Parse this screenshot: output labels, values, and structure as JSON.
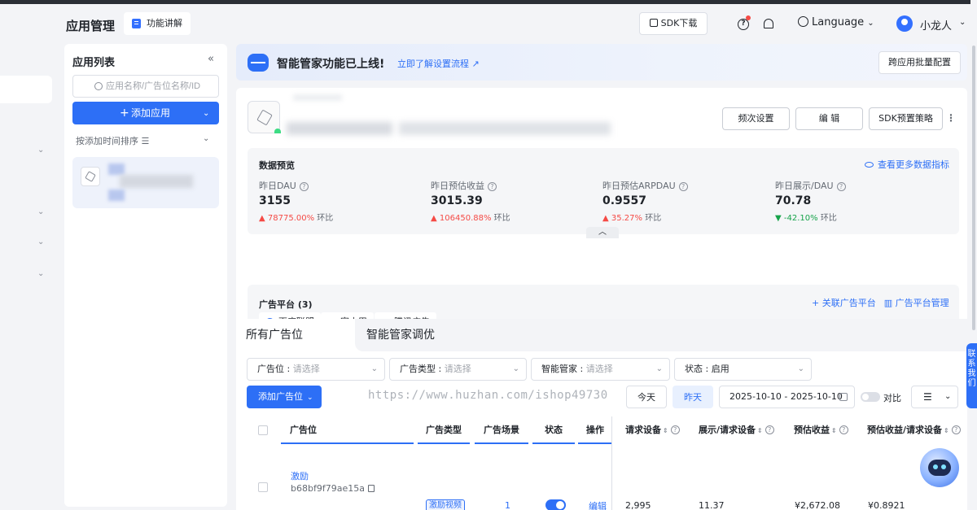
{
  "header": {
    "page_title": "应用管理",
    "func_btn": "功能讲解",
    "sdk_btn": "SDK下载",
    "language": "Language",
    "username": "小龙人"
  },
  "applist": {
    "title": "应用列表",
    "search_placeholder": "应用名称/广告位名称/ID",
    "add_label": "添加应用",
    "sort_label": "按添加时间排序"
  },
  "banner": {
    "title": "智能管家功能已上线!",
    "link": "立即了解设置流程",
    "batch_btn": "跨应用批量配置"
  },
  "app": {
    "actions": [
      "频次设置",
      "编 辑",
      "SDK预置策略"
    ]
  },
  "stats": {
    "title": "数据预览",
    "more": "查看更多数据指标",
    "items": [
      {
        "label": "昨日DAU",
        "value": "3155",
        "change": "78775.00%",
        "suffix": "环比",
        "dir": "up"
      },
      {
        "label": "昨日预估收益",
        "value": "3015.39",
        "change": "106450.88%",
        "suffix": "环比",
        "dir": "up"
      },
      {
        "label": "昨日预估ARPDAU",
        "value": "0.9557",
        "change": "35.27%",
        "suffix": "环比",
        "dir": "up"
      },
      {
        "label": "昨日展示/DAU",
        "value": "70.78",
        "change": "-42.10%",
        "suffix": "环比",
        "dir": "down"
      }
    ]
  },
  "platforms": {
    "title": "广告平台 (3)",
    "link_action": "关联广告平台",
    "manage_action": "广告平台管理",
    "chips": [
      "百度联盟",
      "穿山甲",
      "腾讯广告"
    ]
  },
  "tabs": [
    "所有广告位",
    "智能管家调优"
  ],
  "filters": [
    {
      "label": "广告位 : ",
      "value": "请选择"
    },
    {
      "label": "广告类型 : ",
      "value": "请选择"
    },
    {
      "label": "智能管家 : ",
      "value": "请选择"
    },
    {
      "label": "状态 : ",
      "value": "启用"
    }
  ],
  "toolbar": {
    "add_slot": "添加广告位",
    "watermark": "https://www.huzhan.com/ishop49730",
    "today": "今天",
    "yesterday": "昨天",
    "date_range": "2025-10-10 - 2025-10-10",
    "compare": "对比"
  },
  "table": {
    "headers": [
      "广告位",
      "广告类型",
      "广告场景",
      "状态",
      "操作",
      "请求设备",
      "展示/请求设备",
      "预估收益",
      "预估收益/请求设备"
    ],
    "row": {
      "name": "激励",
      "id": "b68bf9f79ae15a",
      "type": "激励视频",
      "scene": "1",
      "action": "编辑",
      "req_devices": "2,995",
      "show_per_req": "11.37",
      "revenue": "¥2,672.08",
      "revenue_per_req": "¥0.8921"
    }
  },
  "float_tab": "联系我们"
}
